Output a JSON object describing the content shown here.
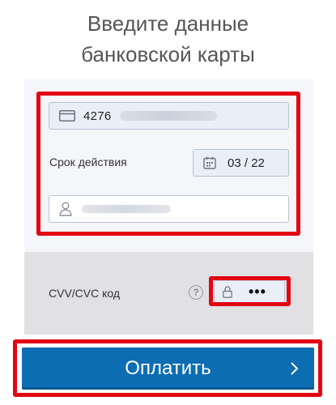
{
  "title": {
    "line1": "Введите данные",
    "line2": "банковской карты"
  },
  "card": {
    "number_prefix": "4276",
    "card_icon": "credit-card-icon",
    "expiry_label": "Срок действия",
    "expiry_value": "03 / 22",
    "calendar_icon": "calendar-icon",
    "holder_icon": "person-icon"
  },
  "cvv": {
    "label": "CVV/CVC код",
    "help_symbol": "?",
    "value_masked": "•••",
    "lock_icon": "lock-icon"
  },
  "pay_button": {
    "label": "Оплатить",
    "chevron_icon": "chevron-right-icon"
  },
  "colors": {
    "highlight": "#e30613",
    "button": "#0c6db3",
    "panel": "#f5f6f9",
    "cvv_panel": "#e1e1e4"
  }
}
